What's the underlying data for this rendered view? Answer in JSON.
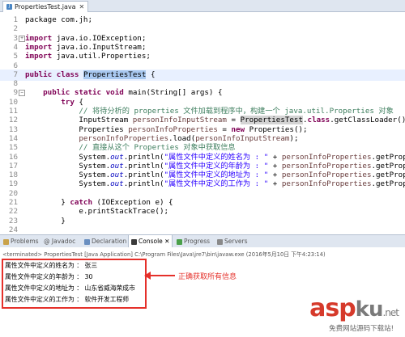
{
  "editor_tab": {
    "title": "PropertiesTest.java",
    "close": "✕"
  },
  "code_lines": [
    {
      "n": "1",
      "parts": [
        {
          "t": "package com.jh;"
        }
      ]
    },
    {
      "n": "2",
      "parts": [
        {
          "t": ""
        }
      ]
    },
    {
      "n": "3",
      "fold": "+",
      "parts": [
        {
          "t": "import",
          "c": "kw"
        },
        {
          "t": " java.io.IOException;"
        }
      ]
    },
    {
      "n": "4",
      "parts": [
        {
          "t": "import",
          "c": "kw"
        },
        {
          "t": " java.io.InputStream;"
        }
      ]
    },
    {
      "n": "5",
      "parts": [
        {
          "t": "import",
          "c": "kw"
        },
        {
          "t": " java.util.Properties;"
        }
      ]
    },
    {
      "n": "6",
      "parts": [
        {
          "t": ""
        }
      ]
    },
    {
      "n": "7",
      "hl": true,
      "parts": [
        {
          "t": "public",
          "c": "kw"
        },
        {
          "t": " "
        },
        {
          "t": "class",
          "c": "kw"
        },
        {
          "t": " "
        },
        {
          "t": "PropertiesTest",
          "c": "sel"
        },
        {
          "t": " {"
        }
      ]
    },
    {
      "n": "8",
      "parts": [
        {
          "t": ""
        }
      ]
    },
    {
      "n": "9",
      "fold": "−",
      "parts": [
        {
          "t": "    "
        },
        {
          "t": "public",
          "c": "kw"
        },
        {
          "t": " "
        },
        {
          "t": "static",
          "c": "kw"
        },
        {
          "t": " "
        },
        {
          "t": "void",
          "c": "kw"
        },
        {
          "t": " main(String[] args) {"
        }
      ]
    },
    {
      "n": "10",
      "parts": [
        {
          "t": "        "
        },
        {
          "t": "try",
          "c": "kw"
        },
        {
          "t": " {"
        }
      ]
    },
    {
      "n": "11",
      "parts": [
        {
          "t": "            "
        },
        {
          "t": "// 将待分析的 properties 文件加载到程序中，构建一个 java.util.Properties 对象",
          "c": "cm"
        }
      ]
    },
    {
      "n": "12",
      "parts": [
        {
          "t": "            InputStream "
        },
        {
          "t": "personInfoInputStream",
          "c": "var"
        },
        {
          "t": " = "
        },
        {
          "t": "PropertiesTest",
          "c": "occ"
        },
        {
          "t": "."
        },
        {
          "t": "class",
          "c": "kw"
        },
        {
          "t": ".getClassLoader().getR"
        }
      ]
    },
    {
      "n": "13",
      "parts": [
        {
          "t": "            Properties "
        },
        {
          "t": "personInfoProperties",
          "c": "var"
        },
        {
          "t": " = "
        },
        {
          "t": "new",
          "c": "kw"
        },
        {
          "t": " Properties();"
        }
      ]
    },
    {
      "n": "14",
      "parts": [
        {
          "t": "            "
        },
        {
          "t": "personInfoProperties",
          "c": "var"
        },
        {
          "t": ".load("
        },
        {
          "t": "personInfoInputStream",
          "c": "var"
        },
        {
          "t": ");"
        }
      ]
    },
    {
      "n": "15",
      "parts": [
        {
          "t": "            "
        },
        {
          "t": "// 直接从这个 Properties 对象中获取信息",
          "c": "cm"
        }
      ]
    },
    {
      "n": "16",
      "parts": [
        {
          "t": "            System."
        },
        {
          "t": "out",
          "c": "fld"
        },
        {
          "t": ".println("
        },
        {
          "t": "\"属性文件中定义的姓名为 : \"",
          "c": "str"
        },
        {
          "t": " + "
        },
        {
          "t": "personInfoProperties",
          "c": "var"
        },
        {
          "t": ".getProperty(\"n"
        }
      ]
    },
    {
      "n": "17",
      "parts": [
        {
          "t": "            System."
        },
        {
          "t": "out",
          "c": "fld"
        },
        {
          "t": ".println("
        },
        {
          "t": "\"属性文件中定义的年龄为 : \"",
          "c": "str"
        },
        {
          "t": " + "
        },
        {
          "t": "personInfoProperties",
          "c": "var"
        },
        {
          "t": ".getProperty(\"a"
        }
      ]
    },
    {
      "n": "18",
      "parts": [
        {
          "t": "            System."
        },
        {
          "t": "out",
          "c": "fld"
        },
        {
          "t": ".println("
        },
        {
          "t": "\"属性文件中定义的地址为 : \"",
          "c": "str"
        },
        {
          "t": " + "
        },
        {
          "t": "personInfoProperties",
          "c": "var"
        },
        {
          "t": ".getProperty(\"a"
        }
      ]
    },
    {
      "n": "19",
      "parts": [
        {
          "t": "            System."
        },
        {
          "t": "out",
          "c": "fld"
        },
        {
          "t": ".println("
        },
        {
          "t": "\"属性文件中定义的工作为 : \"",
          "c": "str"
        },
        {
          "t": " + "
        },
        {
          "t": "personInfoProperties",
          "c": "var"
        },
        {
          "t": ".getProperty(\"j"
        }
      ]
    },
    {
      "n": "20",
      "parts": [
        {
          "t": ""
        }
      ]
    },
    {
      "n": "21",
      "parts": [
        {
          "t": "        } "
        },
        {
          "t": "catch",
          "c": "kw"
        },
        {
          "t": " (IOException e) {"
        }
      ]
    },
    {
      "n": "22",
      "parts": [
        {
          "t": "            e.printStackTrace();"
        }
      ]
    },
    {
      "n": "23",
      "parts": [
        {
          "t": "        }"
        }
      ]
    },
    {
      "n": "24",
      "parts": [
        {
          "t": ""
        }
      ]
    }
  ],
  "view_tabs": {
    "problems": "Problems",
    "javadoc": "@ Javadoc",
    "declaration": "Declaration",
    "console": "Console",
    "console_close": "✕",
    "progress": "Progress",
    "servers": "Servers"
  },
  "console": {
    "terminated": "<terminated> PropertiesTest [Java Application] C:\\Program Files\\Java\\jre7\\bin\\javaw.exe (2016年5月10日 下午4:23:14)",
    "output": [
      "属性文件中定义的姓名为 ： 张三",
      "属性文件中定义的年龄为 ： 30",
      "属性文件中定义的地址为 ： 山东省威海荣成市",
      "属性文件中定义的工作为 ： 软件开发工程师"
    ]
  },
  "annotation": "正确获取所有信息",
  "watermark": {
    "asp": "asp",
    "ku": "ku",
    "dotnet": ".net",
    "sub": "免费网站源码下载站!"
  },
  "colors": {
    "keyword": "#7f0055",
    "comment": "#3f7f5f",
    "string": "#2a00ff",
    "annotation": "#e5302a"
  }
}
